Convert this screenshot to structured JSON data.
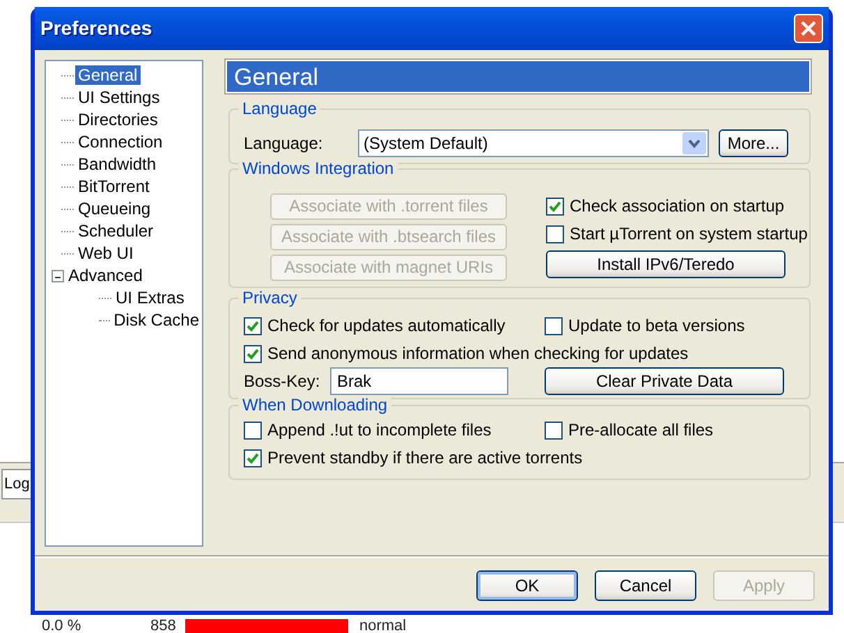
{
  "background_app": {
    "tab": "Log",
    "row": {
      "column_1": "0.0 %",
      "column_2": "858",
      "level": 1,
      "column_4": "normal"
    }
  },
  "window": {
    "title": "Preferences"
  },
  "sidebar": {
    "items": [
      {
        "label": "General",
        "selected": true
      },
      {
        "label": "UI Settings",
        "selected": false
      },
      {
        "label": "Directories",
        "selected": false
      },
      {
        "label": "Connection",
        "selected": false
      },
      {
        "label": "Bandwidth",
        "selected": false
      },
      {
        "label": "BitTorrent",
        "selected": false
      },
      {
        "label": "Queueing",
        "selected": false
      },
      {
        "label": "Scheduler",
        "selected": false
      },
      {
        "label": "Web UI",
        "selected": false
      },
      {
        "label": "Advanced",
        "selected": false,
        "expanded": true,
        "children": [
          {
            "label": "UI Extras",
            "selected": false
          },
          {
            "label": "Disk Cache",
            "selected": false
          }
        ]
      }
    ]
  },
  "panel": {
    "title": "General",
    "language": {
      "legend": "Language",
      "label": "Language:",
      "value": "(System Default)",
      "button": "More..."
    },
    "windows_integration": {
      "legend": "Windows Integration",
      "buttons": [
        {
          "label": "Associate with .torrent files",
          "disabled": true
        },
        {
          "label": "Associate with .btsearch files",
          "disabled": true
        },
        {
          "label": "Associate with magnet URIs",
          "disabled": true
        }
      ],
      "checkboxes": [
        {
          "label": "Check association on startup",
          "checked": true
        },
        {
          "label": "Start µTorrent on system startup",
          "checked": false
        }
      ],
      "install_button": "Install IPv6/Teredo"
    },
    "privacy": {
      "legend": "Privacy",
      "checkboxes": [
        {
          "label": "Check for updates automatically",
          "checked": true
        },
        {
          "label": "Update to beta versions",
          "checked": false
        },
        {
          "label": "Send anonymous information when checking for updates",
          "checked": true
        }
      ],
      "boss_key_label": "Boss-Key:",
      "boss_key_value": "Brak",
      "clear_button": "Clear Private Data"
    },
    "when_downloading": {
      "legend": "When Downloading",
      "checkboxes": [
        {
          "label": "Append .!ut to incomplete files",
          "checked": false
        },
        {
          "label": "Pre-allocate all files",
          "checked": false
        },
        {
          "label": "Prevent standby if there are active torrents",
          "checked": true
        }
      ]
    }
  },
  "buttons": [
    {
      "label": "OK",
      "default": true,
      "disabled": false
    },
    {
      "label": "Cancel",
      "default": false,
      "disabled": false
    },
    {
      "label": "Apply",
      "default": false,
      "disabled": true
    }
  ]
}
